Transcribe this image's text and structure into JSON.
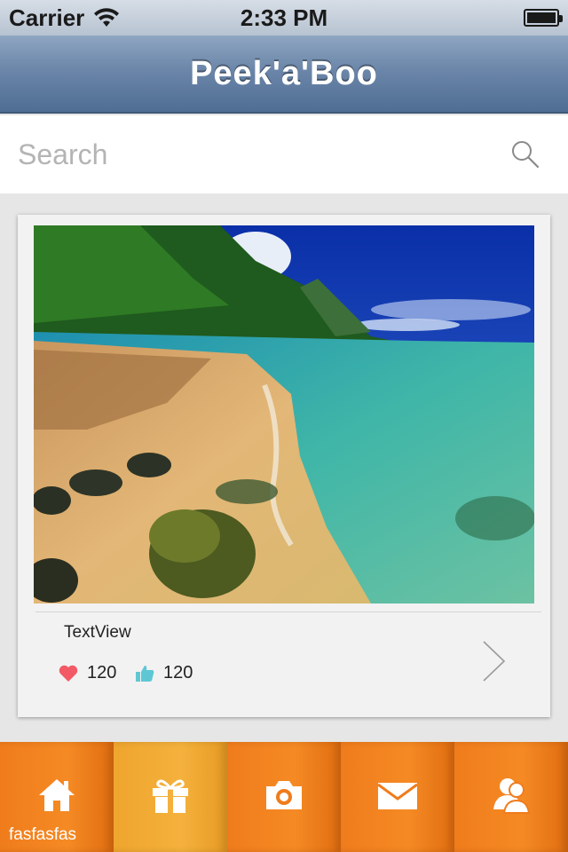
{
  "status_bar": {
    "carrier": "Carrier",
    "time": "2:33 PM",
    "battery_level": 1.0
  },
  "nav_bar": {
    "title": "Peek'a'Boo"
  },
  "search": {
    "placeholder": "Search",
    "value": "",
    "icon": "search-icon"
  },
  "card": {
    "image_description_icon": "beach-photo",
    "title": "TextView",
    "likes": "120",
    "thumbs_up": "120",
    "like_icon": "heart-icon",
    "thumbs_icon": "thumbs-up-icon",
    "chevron_icon": "chevron-right-icon"
  },
  "tab_bar": {
    "tabs": [
      {
        "icon": "home-icon",
        "label": "fasfasfas",
        "active": false
      },
      {
        "icon": "gift-icon",
        "label": "",
        "active": true
      },
      {
        "icon": "camera-icon",
        "label": "",
        "active": false
      },
      {
        "icon": "mail-icon",
        "label": "",
        "active": false
      },
      {
        "icon": "contacts-icon",
        "label": "",
        "active": false
      }
    ]
  },
  "colors": {
    "accent_orange": "#f07c1c",
    "active_tab": "#f4b13c",
    "nav_blue": "#6b86a9",
    "heart": "#f25a66",
    "thumbs": "#5fc7d4"
  }
}
